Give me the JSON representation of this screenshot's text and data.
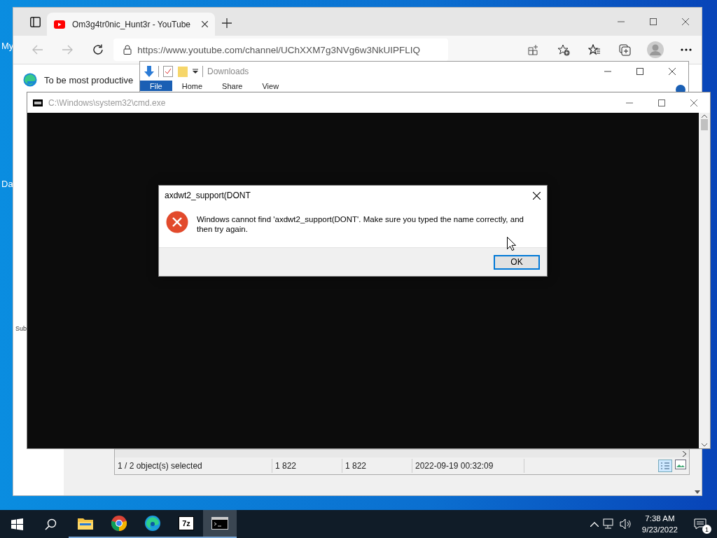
{
  "desktop": {
    "icon_labels": [
      "My",
      "Da"
    ]
  },
  "browser": {
    "tab": {
      "title": "Om3g4tr0nic_Hunt3r - YouTube"
    },
    "address": "https://www.youtube.com/channel/UChXXM7g3NVg6w3NkUIPFLIQ",
    "infobar": "To be most productive",
    "sidebar_text": "Sub"
  },
  "explorer": {
    "title": "Downloads",
    "ribbon": [
      {
        "label": "File",
        "kind": "file"
      },
      {
        "label": "Home",
        "kind": "tab"
      },
      {
        "label": "Share",
        "kind": "tab"
      },
      {
        "label": "View",
        "kind": "tab"
      }
    ]
  },
  "cmd": {
    "title": "C:\\Windows\\system32\\cmd.exe"
  },
  "file_manager": {
    "status": [
      "1 / 2 object(s) selected",
      "1 822",
      "1 822",
      "2022-09-19 00:32:09"
    ]
  },
  "dialog": {
    "title": "axdwt2_support(DONT",
    "message": "Windows cannot find 'axdwt2_support(DONT'. Make sure you typed the name correctly, and then try again.",
    "buttons": [
      "OK"
    ]
  },
  "taskbar": {
    "apps": [
      {
        "kind": "explorer",
        "running": true,
        "active": false
      },
      {
        "kind": "chrome",
        "running": true,
        "active": false
      },
      {
        "kind": "edge",
        "running": true,
        "active": false
      },
      {
        "kind": "archiver",
        "label": "7z",
        "running": true,
        "active": false
      },
      {
        "kind": "terminal",
        "running": true,
        "active": true
      }
    ],
    "clock": {
      "time": "7:38 AM",
      "date": "9/23/2022"
    },
    "notifications": "1"
  }
}
